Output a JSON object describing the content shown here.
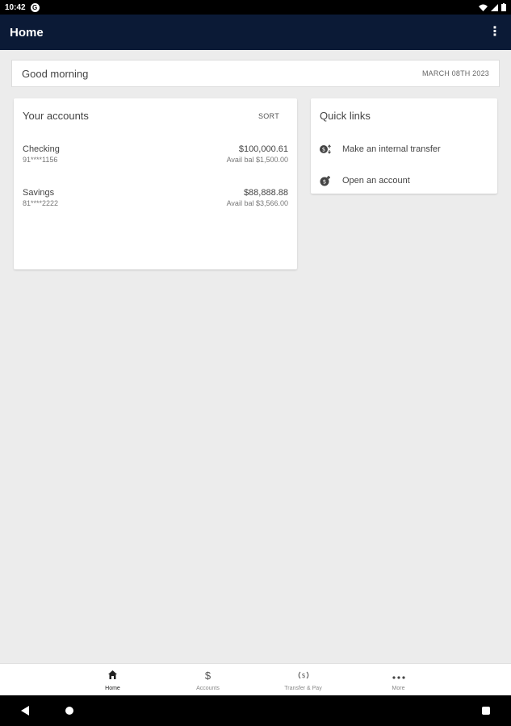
{
  "status_bar": {
    "time": "10:42",
    "g_label": "G"
  },
  "app_bar": {
    "title": "Home",
    "menu_glyph": "⋮"
  },
  "greeting": {
    "text": "Good morning",
    "date": "MARCH 08TH 2023"
  },
  "accounts": {
    "title": "Your accounts",
    "sort_label": "SORT",
    "items": [
      {
        "name": "Checking",
        "number": "91****1156",
        "balance": "$100,000.61",
        "available": "Avail bal $1,500.00"
      },
      {
        "name": "Savings",
        "number": "81****2222",
        "balance": "$88,888.88",
        "available": "Avail bal $3,566.00"
      }
    ]
  },
  "quick_links": {
    "title": "Quick links",
    "items": [
      {
        "icon": "transfer-icon",
        "label": "Make an internal transfer"
      },
      {
        "icon": "open-account-icon",
        "label": "Open an account"
      }
    ]
  },
  "bottom_nav": {
    "items": [
      {
        "icon": "home-icon",
        "label": "Home",
        "active": true
      },
      {
        "icon": "dollar-icon",
        "label": "Accounts",
        "active": false
      },
      {
        "icon": "transfer-pay-icon",
        "label": "Transfer & Pay",
        "active": false
      },
      {
        "icon": "more-icon",
        "label": "More",
        "active": false
      }
    ]
  },
  "colors": {
    "app_bar": "#0b1a36",
    "background": "#ececec",
    "card": "#ffffff"
  }
}
